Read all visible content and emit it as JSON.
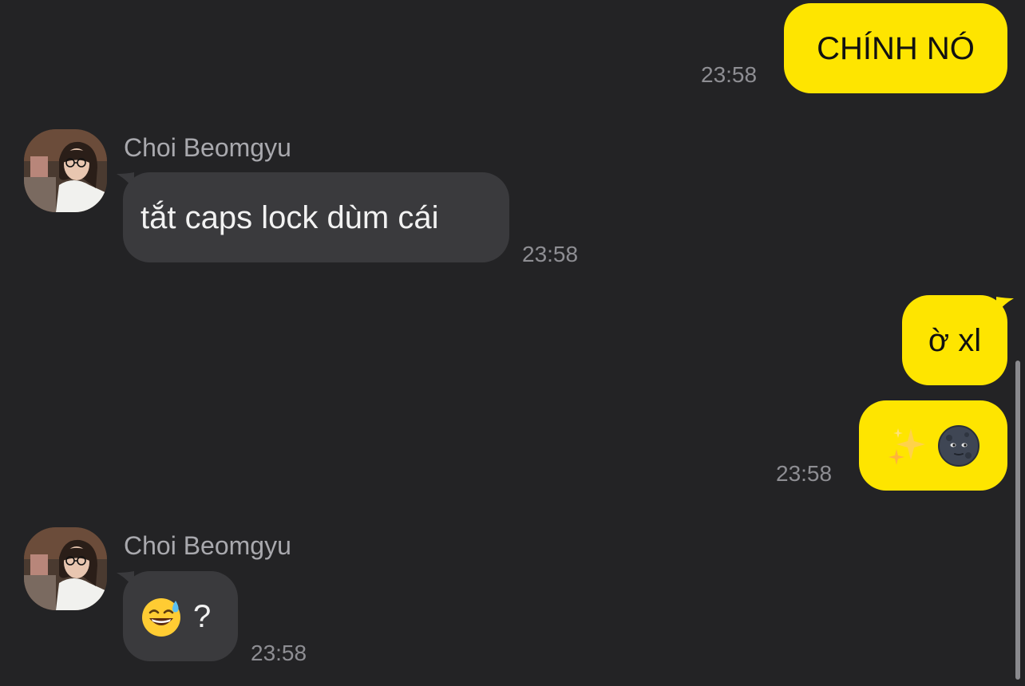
{
  "messages": [
    {
      "direction": "outgoing",
      "text": "CHÍNH NÓ",
      "time": "23:58"
    },
    {
      "direction": "incoming",
      "sender": "Choi Beomgyu",
      "text": "tắt caps lock dùm cái",
      "time": "23:58",
      "avatar": "user-photo"
    },
    {
      "direction": "outgoing",
      "text": "ờ xl"
    },
    {
      "direction": "outgoing",
      "emojis": [
        "sparkles-icon",
        "new-moon-face-icon"
      ],
      "time": "23:58"
    },
    {
      "direction": "incoming",
      "sender": "Choi Beomgyu",
      "emoji": "grinning-face-with-sweat-icon",
      "text": "?",
      "time": "23:58",
      "avatar": "user-photo"
    }
  ],
  "colors": {
    "background": "#232325",
    "outgoing_bubble": "#fee500",
    "incoming_bubble": "#3a3a3d",
    "timestamp": "#8e8e93",
    "sender_name": "#a9a9ae"
  }
}
